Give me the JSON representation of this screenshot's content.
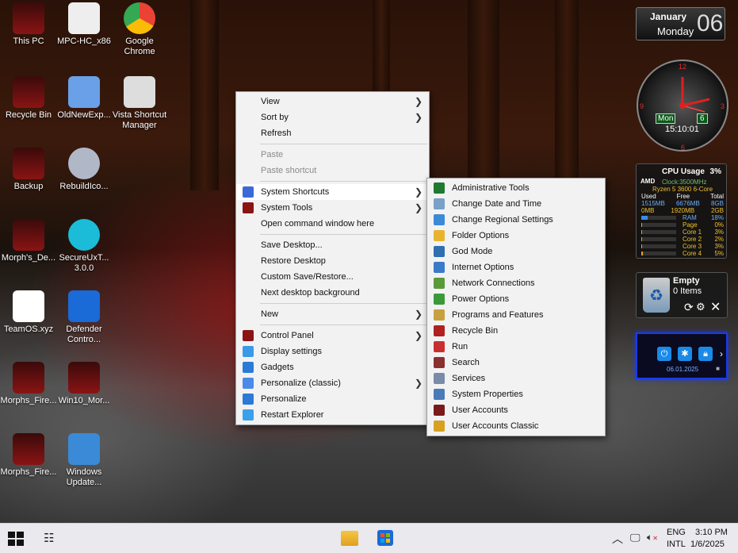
{
  "desktop": {
    "icons": [
      {
        "label": "This PC",
        "icon": "this-pc-icon"
      },
      {
        "label": "MPC-HC_x86",
        "icon": "mpc-hc-icon"
      },
      {
        "label": "Google Chrome",
        "icon": "chrome-icon"
      },
      {
        "label": "Recycle Bin",
        "icon": "recycle-bin-icon"
      },
      {
        "label": "OldNewExp...",
        "icon": "oldnewexplorer-icon"
      },
      {
        "label": "Vista Shortcut Manager",
        "icon": "vista-shortcut-manager-icon"
      },
      {
        "label": "Backup",
        "icon": "backup-icon"
      },
      {
        "label": "RebuildIco...",
        "icon": "rebuild-icon-cache-icon"
      },
      {
        "label": "Morph's_De...",
        "icon": "morphs-de-icon"
      },
      {
        "label": "SecureUxT... 3.0.0",
        "icon": "secureuxtheme-icon"
      },
      {
        "label": "TeamOS.xyz",
        "icon": "teamos-icon"
      },
      {
        "label": "Defender Contro...",
        "icon": "defender-control-icon"
      },
      {
        "label": "Morphs_Fire...",
        "icon": "morphs-fire-icon"
      },
      {
        "label": "Win10_Mor...",
        "icon": "win10-mor-icon"
      },
      {
        "label": "Morphs_Fire...",
        "icon": "morphs-fire-2-icon"
      },
      {
        "label": "Windows Update...",
        "icon": "windows-update-icon"
      }
    ]
  },
  "context_menu": {
    "items": [
      {
        "label": "View",
        "submenu": true
      },
      {
        "label": "Sort by",
        "submenu": true
      },
      {
        "label": "Refresh"
      },
      {
        "label": "Paste",
        "disabled": true
      },
      {
        "label": "Paste shortcut",
        "disabled": true
      },
      {
        "label": "System Shortcuts",
        "submenu": true,
        "highlighted": true,
        "icon": "system-shortcuts-icon"
      },
      {
        "label": "System Tools",
        "submenu": true,
        "icon": "system-tools-icon"
      },
      {
        "label": "Open command window here"
      },
      {
        "label": "Save Desktop..."
      },
      {
        "label": "Restore Desktop"
      },
      {
        "label": "Custom Save/Restore..."
      },
      {
        "label": "Next desktop background"
      },
      {
        "label": "New",
        "submenu": true
      },
      {
        "label": "Control Panel",
        "submenu": true,
        "icon": "control-panel-icon"
      },
      {
        "label": "Display settings",
        "icon": "display-settings-icon"
      },
      {
        "label": "Gadgets",
        "icon": "gadgets-icon"
      },
      {
        "label": "Personalize (classic)",
        "submenu": true,
        "icon": "personalize-classic-icon"
      },
      {
        "label": "Personalize",
        "icon": "personalize-icon"
      },
      {
        "label": "Restart Explorer",
        "icon": "restart-explorer-icon"
      }
    ]
  },
  "submenu_system_shortcuts": {
    "items": [
      {
        "label": "Administrative Tools",
        "icon": "administrative-tools-icon",
        "color": "#1e7a2e"
      },
      {
        "label": "Change Date and Time",
        "icon": "date-time-icon",
        "color": "#7aa0c8"
      },
      {
        "label": "Change Regional Settings",
        "icon": "regional-settings-icon",
        "color": "#3a8ad8"
      },
      {
        "label": "Folder Options",
        "icon": "folder-options-icon",
        "color": "#e8b430"
      },
      {
        "label": "God Mode",
        "icon": "god-mode-icon",
        "color": "#2f6fb0"
      },
      {
        "label": "Internet Options",
        "icon": "internet-options-icon",
        "color": "#3a7ac8"
      },
      {
        "label": "Network Connections",
        "icon": "network-connections-icon",
        "color": "#5a9a3a"
      },
      {
        "label": "Power Options",
        "icon": "power-options-icon",
        "color": "#3a9a3a"
      },
      {
        "label": "Programs and Features",
        "icon": "programs-features-icon",
        "color": "#c8a040"
      },
      {
        "label": "Recycle Bin",
        "icon": "recycle-bin-icon",
        "color": "#b02020"
      },
      {
        "label": "Run",
        "icon": "run-icon",
        "color": "#c83030"
      },
      {
        "label": "Search",
        "icon": "search-icon",
        "color": "#8a3030"
      },
      {
        "label": "Services",
        "icon": "services-icon",
        "color": "#7a8aa8"
      },
      {
        "label": "System Properties",
        "icon": "system-properties-icon",
        "color": "#4a7ab8"
      },
      {
        "label": "User Accounts",
        "icon": "user-accounts-icon",
        "color": "#7a1a1a"
      },
      {
        "label": "User Accounts Classic",
        "icon": "user-accounts-classic-icon",
        "color": "#d8a020"
      }
    ]
  },
  "widgets": {
    "calendar": {
      "month": "January",
      "weekday": "Monday",
      "day": "06"
    },
    "clock": {
      "day_label": "Mon",
      "date_label": "6",
      "time": "15:10:01",
      "numerals": [
        "12",
        "3",
        "6",
        "9"
      ]
    },
    "cpu": {
      "title": "CPU Usage",
      "percent": "3%",
      "brand": "AMD",
      "clock": "Clock:3500MHz",
      "model": "Ryzen 5 3600 6-Core",
      "mem_headers": [
        "Used",
        "Free",
        "Total"
      ],
      "mem_rows": [
        [
          "1515MB",
          "6676MB",
          "8GB"
        ],
        [
          "0MB",
          "1920MB",
          "2GB"
        ]
      ],
      "bars": [
        {
          "label": "RAM",
          "value": "18%",
          "fill": 0.18
        },
        {
          "label": "Page",
          "value": "0%",
          "fill": 0.0
        },
        {
          "label": "Core 1",
          "value": "3%",
          "fill": 0.03
        },
        {
          "label": "Core 2",
          "value": "2%",
          "fill": 0.02
        },
        {
          "label": "Core 3",
          "value": "3%",
          "fill": 0.03
        },
        {
          "label": "Core 4",
          "value": "5%",
          "fill": 0.05
        }
      ]
    },
    "recycle": {
      "title": "Empty",
      "items": "0 Items"
    },
    "lock": {
      "date": "06.01.2025"
    }
  },
  "taskbar": {
    "lang_top": "ENG",
    "lang_bottom": "INTL",
    "time": "3:10 PM",
    "date": "1/6/2025"
  },
  "colors": {
    "accent": "#0a2fd0",
    "menu_bg": "#f2f2f2",
    "taskbar_bg": "#e9e9ee"
  }
}
